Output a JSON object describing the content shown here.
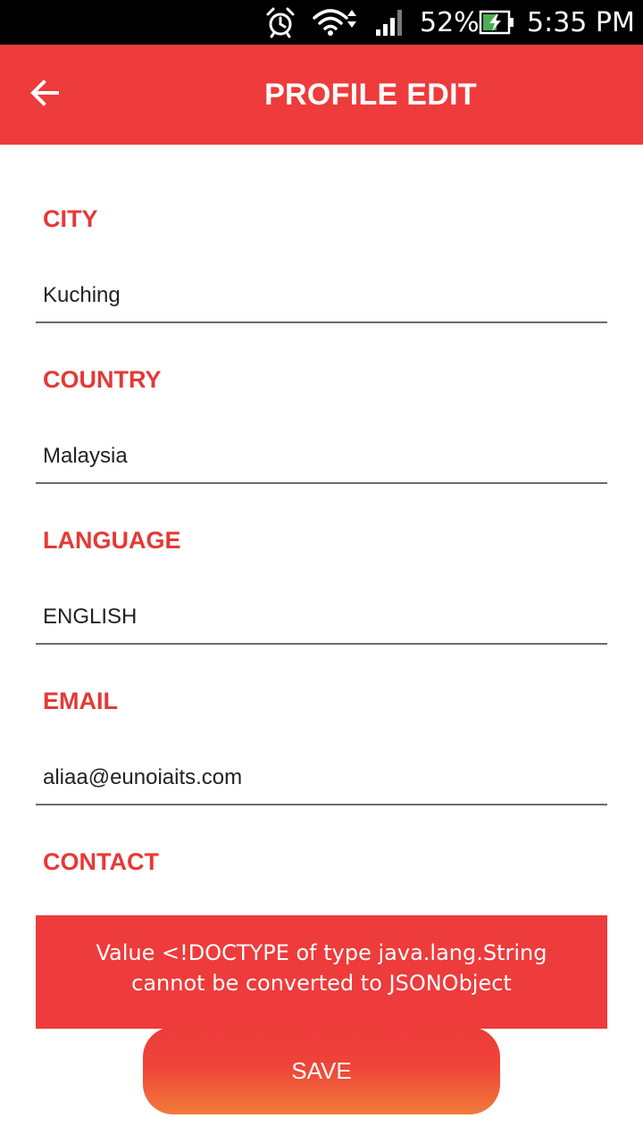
{
  "status_bar": {
    "battery": "52%",
    "time": "5:35 PM",
    "icons": [
      "alarm-icon",
      "wifi-icon",
      "signal-icon",
      "battery-charging-icon"
    ]
  },
  "app_bar": {
    "title": "PROFILE EDIT",
    "back_icon": "arrow-left-icon",
    "color": "#EE3B3B"
  },
  "form": {
    "city": {
      "label": "CITY",
      "value": "Kuching"
    },
    "country": {
      "label": "COUNTRY",
      "value": "Malaysia"
    },
    "language": {
      "label": "LANGUAGE",
      "value": "ENGLISH"
    },
    "email": {
      "label": "EMAIL",
      "value": "aliaa@eunoiaits.com"
    },
    "contact": {
      "label": "CONTACT"
    }
  },
  "toast": {
    "message": "Value <!DOCTYPE of type java.lang.String cannot be converted to JSONObject"
  },
  "save_label": "SAVE",
  "colors": {
    "accent": "#EE3B3B",
    "label": "#E53935",
    "button_gradient_end": "#F07A3A"
  }
}
